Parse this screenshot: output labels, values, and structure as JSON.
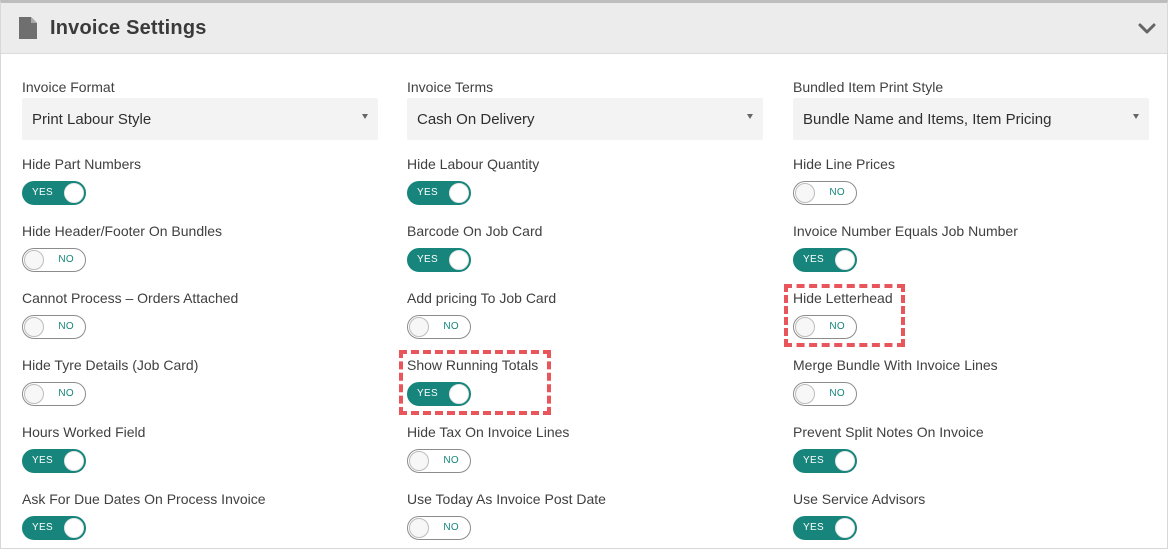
{
  "panel": {
    "title": "Invoice Settings",
    "icons": {
      "title_icon": "document-icon",
      "collapse_icon": "chevron-down-icon"
    }
  },
  "colors": {
    "toggle_on": "#17857b",
    "highlight": "#e8555b"
  },
  "selects": [
    {
      "label": "Invoice Format",
      "value": "Print Labour Style"
    },
    {
      "label": "Invoice Terms",
      "value": "Cash On Delivery"
    },
    {
      "label": "Bundled Item Print Style",
      "value": "Bundle Name and Items, Item Pricing"
    }
  ],
  "toggles": [
    {
      "label": "Hide Part Numbers",
      "state": "YES"
    },
    {
      "label": "Hide Labour Quantity",
      "state": "YES"
    },
    {
      "label": "Hide Line Prices",
      "state": "NO"
    },
    {
      "label": "Hide Header/Footer On Bundles",
      "state": "NO"
    },
    {
      "label": "Barcode On Job Card",
      "state": "YES"
    },
    {
      "label": "Invoice Number Equals Job Number",
      "state": "YES"
    },
    {
      "label": "Cannot Process – Orders Attached",
      "state": "NO"
    },
    {
      "label": "Add pricing To Job Card",
      "state": "NO"
    },
    {
      "label": "Hide Letterhead",
      "state": "NO"
    },
    {
      "label": "Hide Tyre Details (Job Card)",
      "state": "NO"
    },
    {
      "label": "Show Running Totals",
      "state": "YES"
    },
    {
      "label": "Merge Bundle With Invoice Lines",
      "state": "NO"
    },
    {
      "label": "Hours Worked Field",
      "state": "YES"
    },
    {
      "label": "Hide Tax On Invoice Lines",
      "state": "NO"
    },
    {
      "label": "Prevent Split Notes On Invoice",
      "state": "YES"
    },
    {
      "label": "Ask For Due Dates On Process Invoice",
      "state": "YES"
    },
    {
      "label": "Use Today As Invoice Post Date",
      "state": "NO"
    },
    {
      "label": "Use Service Advisors",
      "state": "YES"
    }
  ],
  "highlights": [
    "Hide Letterhead",
    "Show Running Totals"
  ]
}
